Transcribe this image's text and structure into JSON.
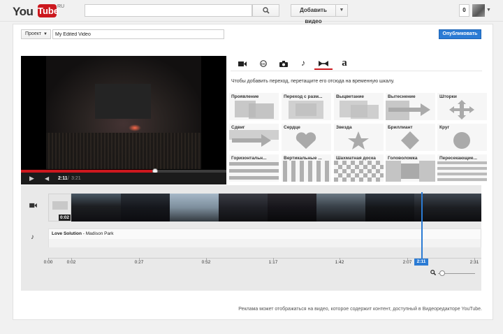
{
  "header": {
    "logo_you": "You",
    "logo_tube": "Tube",
    "logo_region": "RU",
    "search_placeholder": "",
    "upload_label": "Добавить видео",
    "notifications_count": "0"
  },
  "project": {
    "menu_label": "Проект",
    "title_value": "My Edited Video",
    "publish_label": "Опубликовать"
  },
  "player": {
    "current_time": "2:11",
    "separator": "/",
    "duration": "3:21",
    "progress_fraction": 0.652
  },
  "tabs": [
    {
      "icon": "video-camera-icon",
      "glyph": "■"
    },
    {
      "icon": "cc-icon",
      "glyph": "©"
    },
    {
      "icon": "photo-camera-icon",
      "glyph": "◙"
    },
    {
      "icon": "music-note-icon",
      "glyph": "♪"
    },
    {
      "icon": "transitions-icon",
      "glyph": "⋈"
    },
    {
      "icon": "text-icon",
      "glyph": "a"
    }
  ],
  "active_tab_index": 4,
  "transitions": {
    "hint": "Чтобы добавить переход, перетащите его отсюда на временную шкалу.",
    "items": [
      {
        "label": "Проявление",
        "kind": "fade"
      },
      {
        "label": "Переход с разм...",
        "kind": "blur"
      },
      {
        "label": "Выцветание",
        "kind": "fade2"
      },
      {
        "label": "Вытеснение",
        "kind": "arrow-right"
      },
      {
        "label": "Шторки",
        "kind": "cross-arrows"
      },
      {
        "label": "Сдвиг",
        "kind": "slide"
      },
      {
        "label": "Сердце",
        "kind": "heart"
      },
      {
        "label": "Звезда",
        "kind": "star"
      },
      {
        "label": "Бриллиант",
        "kind": "diamond"
      },
      {
        "label": "Круг",
        "kind": "circle"
      },
      {
        "label": "Горизонтальн...",
        "kind": "hbars"
      },
      {
        "label": "Вертикальные ...",
        "kind": "vbars"
      },
      {
        "label": "Шахматная доска",
        "kind": "checker"
      },
      {
        "label": "Головоломка",
        "kind": "puzzle"
      },
      {
        "label": "Пересекающие...",
        "kind": "hstripes"
      }
    ]
  },
  "timeline": {
    "first_clip_duration": "0:02",
    "audio_title": "Love Solution",
    "audio_separator": " - ",
    "audio_artist": "Madison Park",
    "ticks": [
      "0:00",
      "0:02",
      "0:27",
      "0:52",
      "1:17",
      "1:42",
      "2:07",
      "2:31"
    ],
    "playhead_time": "2:11"
  },
  "footer_note": "Реклама может отображаться на видео, которое содержит контент, доступный в Видеоредакторе YouTube.",
  "colors": {
    "accent_blue": "#2b7bd4",
    "youtube_red": "#cc181e"
  }
}
